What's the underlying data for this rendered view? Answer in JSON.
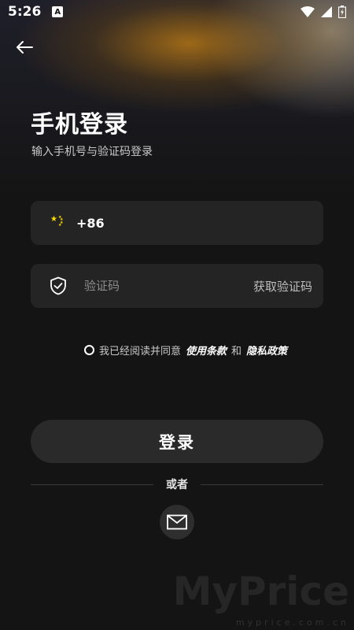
{
  "status_bar": {
    "time": "5:26",
    "app_badge": "A"
  },
  "header": {
    "title": "手机登录",
    "subtitle": "输入手机号与验证码登录"
  },
  "phone": {
    "dial_code": "+86"
  },
  "code": {
    "placeholder": "验证码",
    "get_code_label": "获取验证码"
  },
  "agreement": {
    "prefix": "我已经阅读并同意",
    "terms": "使用条款",
    "and": "和",
    "privacy": "隐私政策"
  },
  "login_label": "登录",
  "divider_text": "或者",
  "watermark": {
    "main": "MyPrice",
    "sub": "myprice.com.cn"
  }
}
